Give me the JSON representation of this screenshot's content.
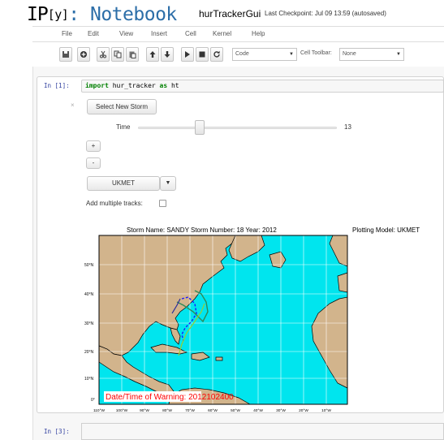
{
  "header": {
    "logo_ip": "IP",
    "logo_y": "[y]",
    "logo_rest": ": Notebook",
    "notebook_name": "hurTrackerGui",
    "checkpoint": "Last Checkpoint: Jul 09 13:59 (autosaved)"
  },
  "menu": {
    "items": [
      "File",
      "Edit",
      "View",
      "Insert",
      "Cell",
      "Kernel",
      "Help"
    ]
  },
  "toolbar": {
    "cell_type": "Code",
    "cell_toolbar_label": "Cell Toolbar:",
    "cell_toolbar_value": "None",
    "icons": [
      "save-icon",
      "plus-icon",
      "cut-icon",
      "copy-icon",
      "paste-icon",
      "arrow-up-icon",
      "arrow-down-icon",
      "run-icon",
      "stop-icon",
      "restart-icon"
    ]
  },
  "cell1": {
    "prompt": "In [1]:",
    "code_kw1": "import",
    "code_mod": " hur_tracker ",
    "code_kw2": "as",
    "code_alias": " ht"
  },
  "widgets": {
    "close_label": "×",
    "select_storm_label": "Select New Storm",
    "time_label": "Time",
    "time_value": "13",
    "time_fraction": 0.3,
    "plus_label": "+",
    "minus_label": "-",
    "model_value": "UKMET",
    "multi_label": "Add multiple tracks:"
  },
  "plot": {
    "title": "Storm Name: SANDY   Storm Number: 18   Year: 2012",
    "model": "Plotting Model: UKMET",
    "warning": "Date/Time of Warning: 2012102400",
    "lat_labels": [
      "50°N",
      "40°N",
      "30°N",
      "20°N",
      "10°N",
      "0°"
    ],
    "lon_labels": [
      "110°W",
      "100°W",
      "90°W",
      "80°W",
      "70°W",
      "60°W",
      "50°W",
      "40°W",
      "30°W",
      "20°W",
      "10°W"
    ],
    "colors": {
      "ocean": "#00e5ee",
      "land": "#d2b48c",
      "track_observed": "#1a1aff",
      "track_forecast": "#2e8b57",
      "track_other": "#9acd32",
      "warning_text": "#ff0000"
    }
  },
  "cell3": {
    "prompt": "In [3]:"
  }
}
